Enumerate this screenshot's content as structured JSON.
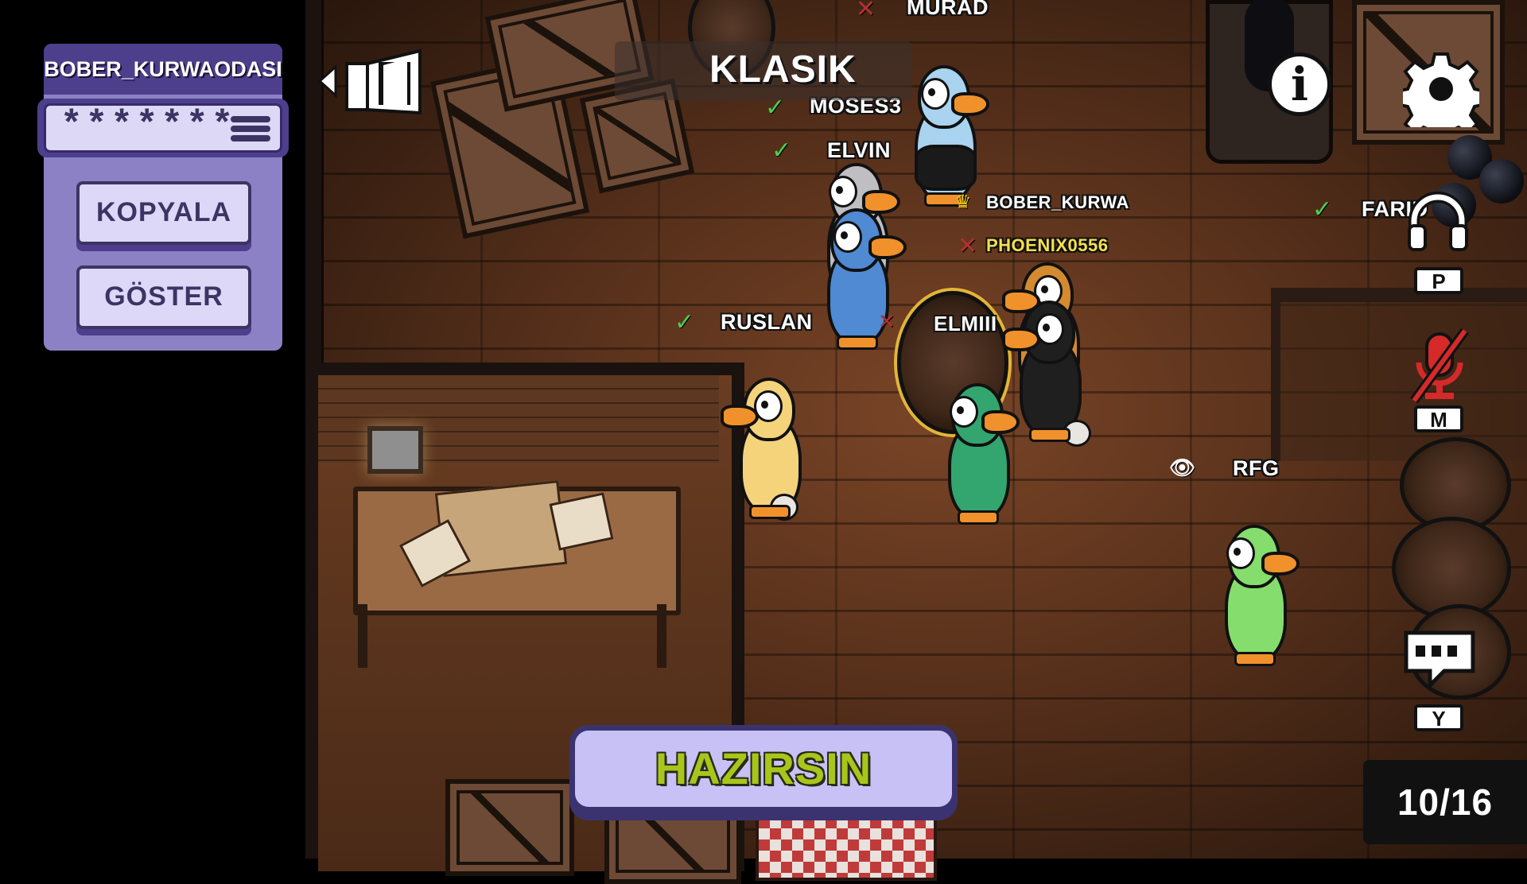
{
  "room_panel": {
    "title": "BOBER_KURWAODASI",
    "code_masked": "*******",
    "copy_label": "KOPYALA",
    "show_label": "GÖSTER"
  },
  "header": {
    "mode": "KLASIK"
  },
  "players": [
    {
      "name": "MURAD",
      "status": "not-ready"
    },
    {
      "name": "MOSES3",
      "status": "ready"
    },
    {
      "name": "ELVIN",
      "status": "ready"
    },
    {
      "name": "BOBER_KURWA",
      "status": "host"
    },
    {
      "name": "PHOENIX0556",
      "status": "not-ready"
    },
    {
      "name": "RUSLAN",
      "status": "ready"
    },
    {
      "name": "ELMIII",
      "status": "not-ready"
    },
    {
      "name": "FARID",
      "status": "ready"
    },
    {
      "name": "RFG",
      "status": "spectating"
    }
  ],
  "controls": {
    "voice_key": "P",
    "mute_key": "M",
    "chat_key": "Y"
  },
  "ready_button": "HAZIRSIN",
  "player_count": "10/16",
  "colors": {
    "panel": "#8c81c5",
    "panel_dark": "#4d3f8c",
    "ready_text": "#a8c61a",
    "host_name": "#f4e04d",
    "check": "#4ccf4f",
    "cross": "#b23131"
  }
}
